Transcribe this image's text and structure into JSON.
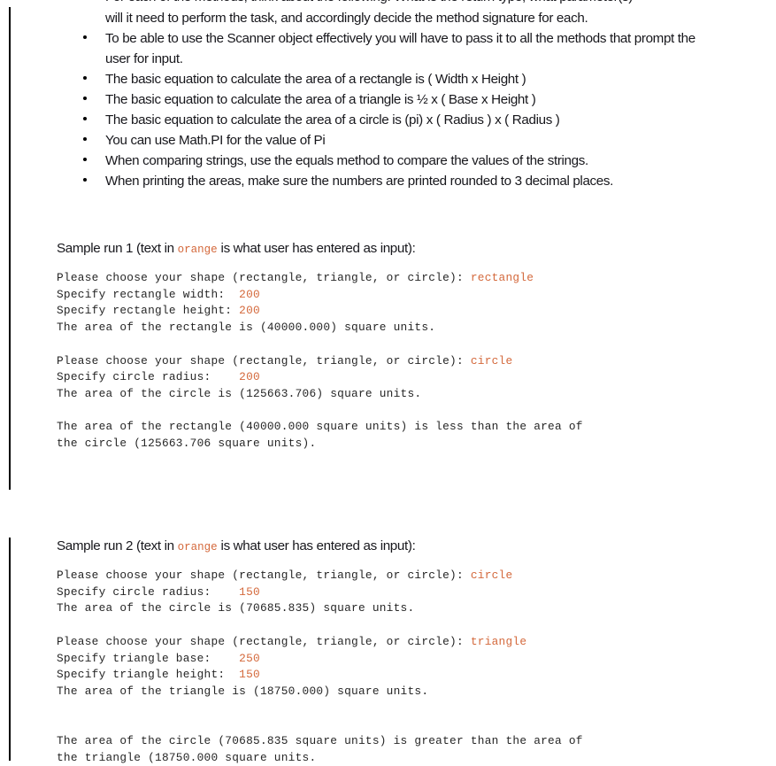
{
  "colors": {
    "user_input_orange": "#d4693c",
    "text": "#17171c",
    "console_text": "#262626",
    "change_bar": "#000000"
  },
  "intro": {
    "clipped_line": "For each of the methods, think about the following: What is the return type, what parameter(s)",
    "continuation_line": "will it need to perform the task, and accordingly decide the method signature for each."
  },
  "bullets": [
    {
      "text": "To be able to use the Scanner object effectively  you will have to pass it to all the methods that prompt the user for input."
    },
    {
      "text": "The basic equation to calculate the area of a rectangle is ( Width x Height )"
    },
    {
      "text": "The basic equation to calculate the area of a triangle is ½ x ( Base x Height )"
    },
    {
      "text": "The basic equation to calculate the area of a circle is (pi) x ( Radius ) x ( Radius )"
    },
    {
      "text": "You can use Math.PI for the value of Pi"
    },
    {
      "text": "When comparing strings, use the equals method to compare the values of the strings."
    },
    {
      "text": "When printing the areas, make sure the numbers are printed rounded to 3 decimal places."
    }
  ],
  "samples": [
    {
      "heading_before": "Sample run 1 (text in ",
      "heading_orange_word": "orange",
      "heading_after": " is what user has entered as input):",
      "console": [
        {
          "type": "line",
          "prompt": "Please choose your shape (rectangle, triangle, or circle): ",
          "input": "rectangle"
        },
        {
          "type": "line",
          "prompt": "Specify rectangle width:  ",
          "input": "200"
        },
        {
          "type": "line",
          "prompt": "Specify rectangle height: ",
          "input": "200"
        },
        {
          "type": "line",
          "prompt": "The area of the rectangle is (40000.000) square units.",
          "input": ""
        },
        {
          "type": "blank"
        },
        {
          "type": "line",
          "prompt": "Please choose your shape (rectangle, triangle, or circle): ",
          "input": "circle"
        },
        {
          "type": "line",
          "prompt": "Specify circle radius:    ",
          "input": "200"
        },
        {
          "type": "line",
          "prompt": "The area of the circle is (125663.706) square units.",
          "input": ""
        },
        {
          "type": "blank"
        },
        {
          "type": "line",
          "prompt": "The area of the rectangle (40000.000 square units) is less than the area of",
          "input": ""
        },
        {
          "type": "line",
          "prompt": "the circle (125663.706 square units).",
          "input": ""
        }
      ]
    },
    {
      "heading_before": "Sample run 2 (text in ",
      "heading_orange_word": "orange",
      "heading_after": " is what user has entered as input):",
      "console": [
        {
          "type": "line",
          "prompt": "Please choose your shape (rectangle, triangle, or circle): ",
          "input": "circle"
        },
        {
          "type": "line",
          "prompt": "Specify circle radius:    ",
          "input": "150"
        },
        {
          "type": "line",
          "prompt": "The area of the circle is (70685.835) square units.",
          "input": ""
        },
        {
          "type": "blank"
        },
        {
          "type": "line",
          "prompt": "Please choose your shape (rectangle, triangle, or circle): ",
          "input": "triangle"
        },
        {
          "type": "line",
          "prompt": "Specify triangle base:    ",
          "input": "250"
        },
        {
          "type": "line",
          "prompt": "Specify triangle height:  ",
          "input": "150"
        },
        {
          "type": "line",
          "prompt": "The area of the triangle is (18750.000) square units.",
          "input": ""
        },
        {
          "type": "blank"
        },
        {
          "type": "blank"
        },
        {
          "type": "line",
          "prompt": "The area of the circle (70685.835 square units) is greater than the area of",
          "input": ""
        },
        {
          "type": "line",
          "prompt": "the triangle (18750.000 square units.",
          "input": ""
        }
      ]
    }
  ]
}
